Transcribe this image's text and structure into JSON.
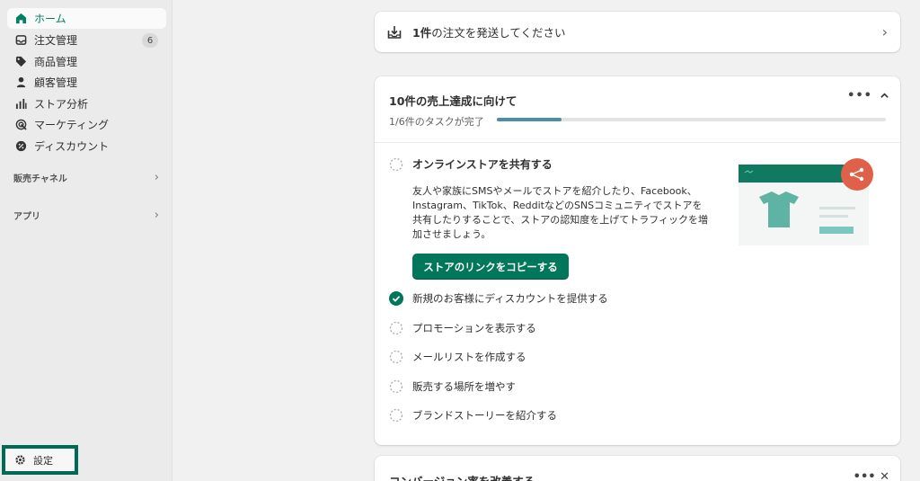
{
  "sidebar": {
    "items": [
      {
        "label": "ホーム",
        "icon": "home-icon"
      },
      {
        "label": "注文管理",
        "icon": "inbox-icon",
        "badge": "6"
      },
      {
        "label": "商品管理",
        "icon": "tag-icon"
      },
      {
        "label": "顧客管理",
        "icon": "person-icon"
      },
      {
        "label": "ストア分析",
        "icon": "bar-chart-icon"
      },
      {
        "label": "マーケティング",
        "icon": "target-icon"
      },
      {
        "label": "ディスカウント",
        "icon": "discount-icon"
      }
    ],
    "sales_channels": "販売チャネル",
    "apps": "アプリ",
    "settings": "設定"
  },
  "ship_card": {
    "count": "1件",
    "text": "の注文を発送してください"
  },
  "goal_card": {
    "title": "10件の売上達成に向けて",
    "progress_label": "1/6件のタスクが完了",
    "progress_fraction": 0.167,
    "tasks": [
      {
        "label": "オンラインストアを共有する",
        "done": false,
        "expanded": true
      },
      {
        "label": "新規のお客様にディスカウントを提供する",
        "done": true
      },
      {
        "label": "プロモーションを表示する",
        "done": false
      },
      {
        "label": "メールリストを作成する",
        "done": false
      },
      {
        "label": "販売する場所を増やす",
        "done": false
      },
      {
        "label": "ブランドストーリーを紹介する",
        "done": false
      }
    ],
    "description": "友人や家族にSMSやメールでストアを紹介したり、Facebook、Instagram、TikTok、RedditなどのSNSコミュニティでストアを共有したりすることで、ストアの認知度を上げてトラフィックを増加させましょう。",
    "button": "ストアのリンクをコピーする"
  },
  "conv_card": {
    "title": "コンバージョン率を改善する"
  },
  "colors": {
    "accent": "#00775a",
    "active_home": "#008060",
    "progress": "#4a90a4",
    "share_badge": "#e0614a",
    "settings_border": "#006b54"
  }
}
